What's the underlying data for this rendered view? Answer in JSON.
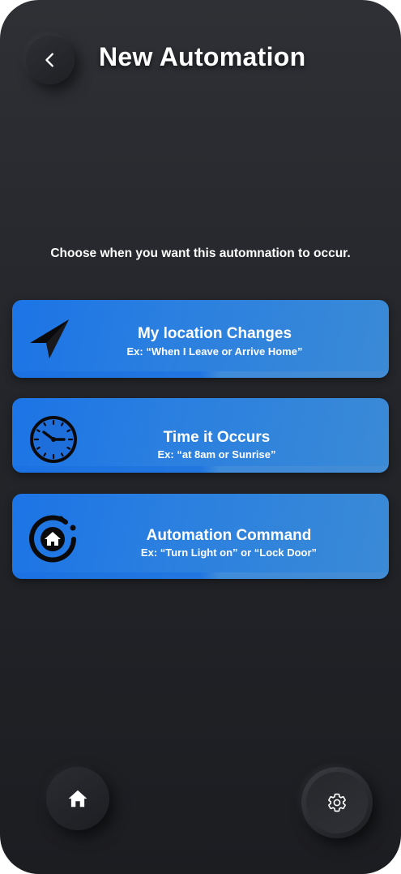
{
  "header": {
    "title": "New Automation",
    "back_icon": "chevron-left-icon"
  },
  "instruction": "Choose when you want this automnation to occur.",
  "options": [
    {
      "title": "My location Changes",
      "subtitle": "Ex: “When I Leave or Arrive Home”",
      "icon": "location-arrow-icon"
    },
    {
      "title": "Time it Occurs",
      "subtitle": "Ex: “at 8am or Sunrise”",
      "icon": "clock-icon"
    },
    {
      "title": "Automation Command",
      "subtitle": "Ex: “Turn Light on” or “Lock Door”",
      "icon": "smart-home-icon"
    }
  ],
  "bottom_nav": {
    "home_icon": "home-icon",
    "settings_icon": "gear-icon"
  },
  "colors": {
    "card_blue": "#2a7fe0",
    "background": "#24262b",
    "text": "#ffffff"
  }
}
